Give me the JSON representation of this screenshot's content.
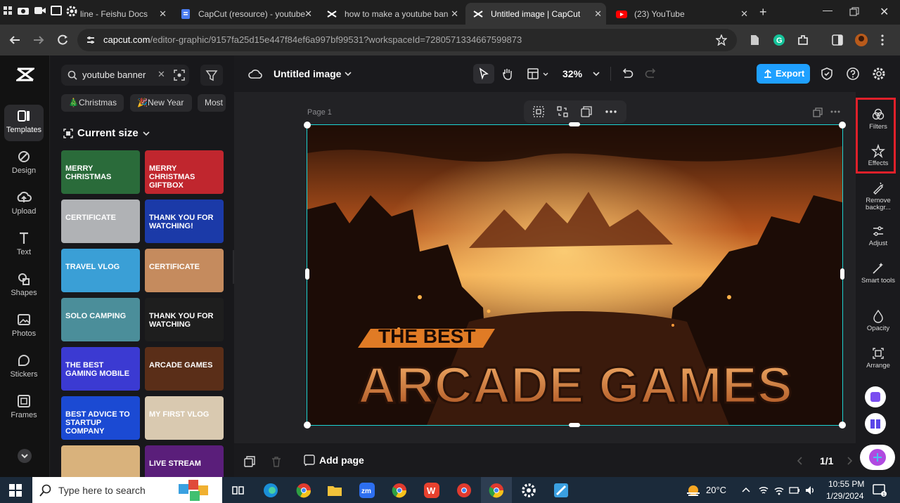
{
  "browser": {
    "tabs": [
      {
        "title": "line - Feishu Docs"
      },
      {
        "title": "CapCut (resource) - youtube"
      },
      {
        "title": "how to make a youtube ban"
      },
      {
        "title": "Untitled image | CapCut"
      },
      {
        "title": "(23) YouTube"
      }
    ],
    "url_host": "capcut.com",
    "url_path": "/editor-graphic/9157fa25d15e447f84ef6a997bf99531?workspaceId=7280571334667599873"
  },
  "left_rail": [
    {
      "label": "Templates",
      "icon": "templates-icon"
    },
    {
      "label": "Design",
      "icon": "design-icon"
    },
    {
      "label": "Upload",
      "icon": "upload-icon"
    },
    {
      "label": "Text",
      "icon": "text-icon"
    },
    {
      "label": "Shapes",
      "icon": "shapes-icon"
    },
    {
      "label": "Photos",
      "icon": "photos-icon"
    },
    {
      "label": "Stickers",
      "icon": "stickers-icon"
    },
    {
      "label": "Frames",
      "icon": "frames-icon"
    }
  ],
  "panel": {
    "search_value": "youtube banner",
    "chips": [
      "🎄Christmas",
      "🎉New Year",
      "Most"
    ],
    "size_label": "Current size",
    "thumbs": [
      {
        "text": "MERRY CHRISTMAS",
        "bg": "#2a6b3a"
      },
      {
        "text": "MERRY CHRISTMAS GIFTBOX",
        "bg": "#c0262e"
      },
      {
        "text": "CERTIFICATE",
        "bg": "#b0b2b5"
      },
      {
        "text": "THANK YOU FOR WATCHING!",
        "bg": "#1b3aa8"
      },
      {
        "text": "TRAVEL VLOG",
        "bg": "#3a9fd6"
      },
      {
        "text": "CERTIFICATE",
        "bg": "#c58b5e"
      },
      {
        "text": "SOLO CAMPING",
        "bg": "#4b8e9a"
      },
      {
        "text": "THANK YOU FOR WATCHING",
        "bg": "#1e1e1e"
      },
      {
        "text": "THE BEST GAMING MOBILE",
        "bg": "#3b3ad2"
      },
      {
        "text": "ARCADE GAMES",
        "bg": "#5a2e18"
      },
      {
        "text": "BEST ADVICE TO STARTUP COMPANY",
        "bg": "#1b4ad3"
      },
      {
        "text": "MY FIRST VLOG",
        "bg": "#d9c9b0"
      },
      {
        "text": "",
        "bg": "#d9b27c"
      },
      {
        "text": "LIVE STREAM",
        "bg": "#5a1e7a"
      }
    ]
  },
  "topbar": {
    "title": "Untitled image",
    "zoom": "32%",
    "export_label": "Export"
  },
  "canvas": {
    "page_label": "Page 1",
    "headline_small": "THE BEST",
    "headline_big": "ARCADE GAMES"
  },
  "right_rail": [
    {
      "label": "Filters",
      "icon": "filters-icon"
    },
    {
      "label": "Effects",
      "icon": "effects-icon"
    },
    {
      "label": "Remove backgr...",
      "icon": "remove-bg-icon"
    },
    {
      "label": "Adjust",
      "icon": "adjust-icon"
    },
    {
      "label": "Smart tools",
      "icon": "smart-tools-icon"
    },
    {
      "label": "Opacity",
      "icon": "opacity-icon"
    },
    {
      "label": "Arrange",
      "icon": "arrange-icon"
    }
  ],
  "bottombar": {
    "add_page": "Add page",
    "page_counter": "1/1"
  },
  "taskbar": {
    "search_placeholder": "Type here to search",
    "temperature": "20°C",
    "time": "10:55 PM",
    "date": "1/29/2024"
  },
  "colors": {
    "accent": "#1fa0ff",
    "selection": "#1dd5d5",
    "highlight_box": "#e0202a"
  }
}
